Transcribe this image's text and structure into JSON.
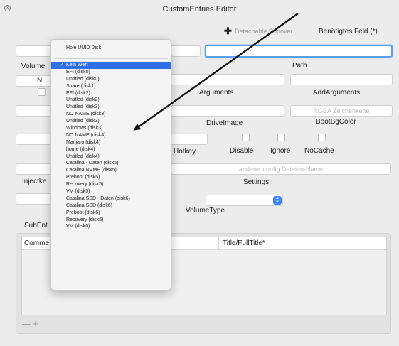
{
  "window": {
    "title": "CustomEntries Editor",
    "close_glyph": "×"
  },
  "toolbar": {
    "add_glyph": "✚",
    "detach_label": "Detachable Popover",
    "required_label": "Benötigtes Feld (*)"
  },
  "labels": {
    "volume": "Volume",
    "n": "N",
    "path": "Path",
    "arguments": "Arguments",
    "add_arguments": "AddArguments",
    "drive_image": "DriveImage",
    "boot_bg_color": "BootBgColor",
    "hotkey": "Hotkey",
    "disable": "Disable",
    "ignore": "Ignore",
    "no_cache": "NoCache",
    "injectke": "Injectke",
    "settings": "Settings",
    "volume_type": "VolumeType",
    "sub_entries": "SubEnt"
  },
  "placeholders": {
    "boot_bg_color": "RGBA Zeichenkette",
    "settings": "anderer config Dateien-Name"
  },
  "table": {
    "col1": "Comme",
    "col2": "Title/FullTitle*"
  },
  "table_buttons": "—+",
  "popup": {
    "top_item": "Hole UUID Disk",
    "check_glyph": "✓",
    "items": [
      "Kein Wert",
      "EFI (disk0)",
      "Untitled (disk0)",
      "Share (disk1)",
      "EFI (disk2)",
      "Untitled (disk2)",
      "Untitled (disk3)",
      "NO NAME (disk3)",
      "Untitled (disk3)",
      "Windows (disk3)",
      "NO NAME (disk4)",
      "Manjaro (disk4)",
      "home (disk4)",
      "Untitled (disk4)",
      "Catalina - Daten (disk5)",
      "Catalina NVME (disk5)",
      "Preboot (disk5)",
      "Recovery (disk5)",
      "VM (disk5)",
      "Catalina SSD - Daten (disk6)",
      "Catalina SSD (disk6)",
      "Preboot (disk6)",
      "Recovery (disk6)",
      "VM (disk6)"
    ],
    "selected_index": 0
  },
  "colors": {
    "accent": "#2f6fe5",
    "focus": "#5a9ff2",
    "arrow": "#111111"
  }
}
